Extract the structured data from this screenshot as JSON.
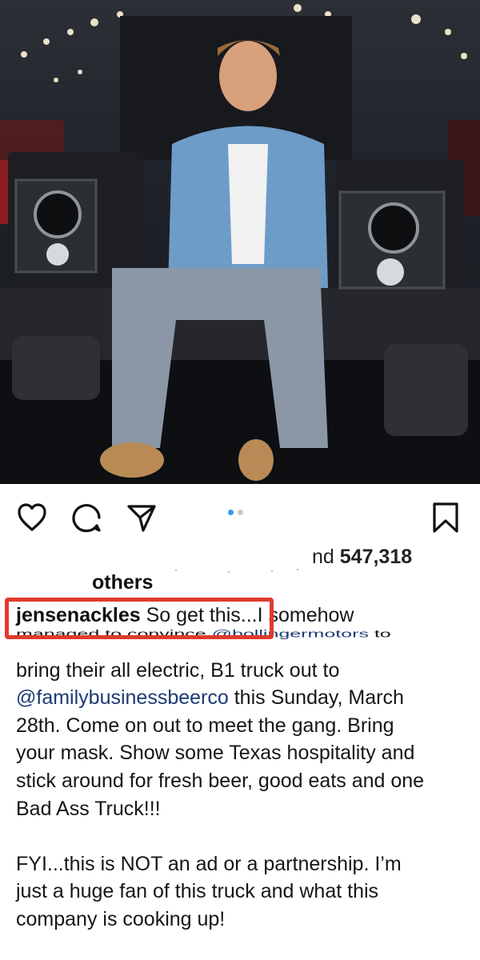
{
  "post": {
    "likes_prefix": "nd",
    "likes_count": "547,318",
    "likes_suffix": "others",
    "caption": {
      "username": "jensenackles",
      "line1": "So get this...I somehow",
      "line2_part1": "managed to convince ",
      "mention1": "@bollingermotors",
      "line2_part2": " to",
      "line3": "bring their all electric, B1 truck out to",
      "mention2": "@familybusinessbeerco",
      "line4_rest": " this Sunday, March",
      "line5": "28th.  Come on out to meet the gang. Bring",
      "line6": "your mask. Show some Texas hospitality and",
      "line7": "stick around for fresh beer, good eats and one",
      "line8": "Bad Ass Truck!!!",
      "line9": "FYI...this is NOT an ad or a partnership.  I’m",
      "line10": "just a huge fan of this truck and what this",
      "line11": "company is cooking up!"
    }
  },
  "carousel": {
    "count": 2,
    "active_index": 0
  },
  "icons": [
    "heart-icon",
    "comment-icon",
    "share-icon",
    "bookmark-icon"
  ],
  "colors": {
    "highlight": "#e0392f",
    "mention": "#1c3a75",
    "active_dot": "#3897f0"
  }
}
